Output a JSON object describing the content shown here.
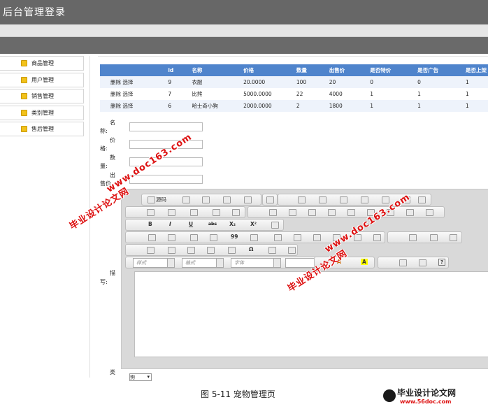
{
  "header": {
    "title": "后台管理登录"
  },
  "sidebar": {
    "items": [
      {
        "label": "商品管理"
      },
      {
        "label": "用户管理"
      },
      {
        "label": "销售管理"
      },
      {
        "label": "类别管理"
      },
      {
        "label": "售后管理"
      }
    ]
  },
  "table": {
    "headers": [
      "",
      "id",
      "名称",
      "价格",
      "数量",
      "出售价",
      "是否特价",
      "是否广告",
      "是否上架"
    ],
    "rows": [
      {
        "actions": "删除 选择",
        "id": "9",
        "name": "衣服",
        "price": "20.0000",
        "qty": "100",
        "sale": "20",
        "special": "0",
        "ad": "0",
        "shelf": "1"
      },
      {
        "actions": "删除 选择",
        "id": "7",
        "name": "比熊",
        "price": "5000.0000",
        "qty": "22",
        "sale": "4000",
        "special": "1",
        "ad": "1",
        "shelf": "1"
      },
      {
        "actions": "删除 选择",
        "id": "6",
        "name": "哈士奇小狗",
        "price": "2000.0000",
        "qty": "2",
        "sale": "1800",
        "special": "1",
        "ad": "1",
        "shelf": "1"
      }
    ]
  },
  "form": {
    "name_label": [
      "名",
      "称:"
    ],
    "price_label": [
      "价",
      "格:"
    ],
    "qty_label": [
      "数",
      "量:"
    ],
    "sale_label": [
      "出",
      "售价"
    ],
    "desc_label": [
      "描",
      "写:"
    ],
    "type_label": "类",
    "type_value": "狗"
  },
  "editor": {
    "source_label": "源码",
    "bold": "B",
    "italic": "I",
    "underline": "U",
    "strike": "abc",
    "sub": "X₂",
    "sup": "X²",
    "quote": "99",
    "style_combo": "样式",
    "format_combo": "格式",
    "font_combo": "字体",
    "textcolor": "A",
    "bgcolor": "A",
    "help": "?",
    "omega": "Ω"
  },
  "watermarks": [
    "毕业设计论文网",
    "www.doc163.com"
  ],
  "caption": "图 5-11  宠物管理页",
  "logo": {
    "main": "毕业设计论文网",
    "sub": "www.56doc.com"
  }
}
